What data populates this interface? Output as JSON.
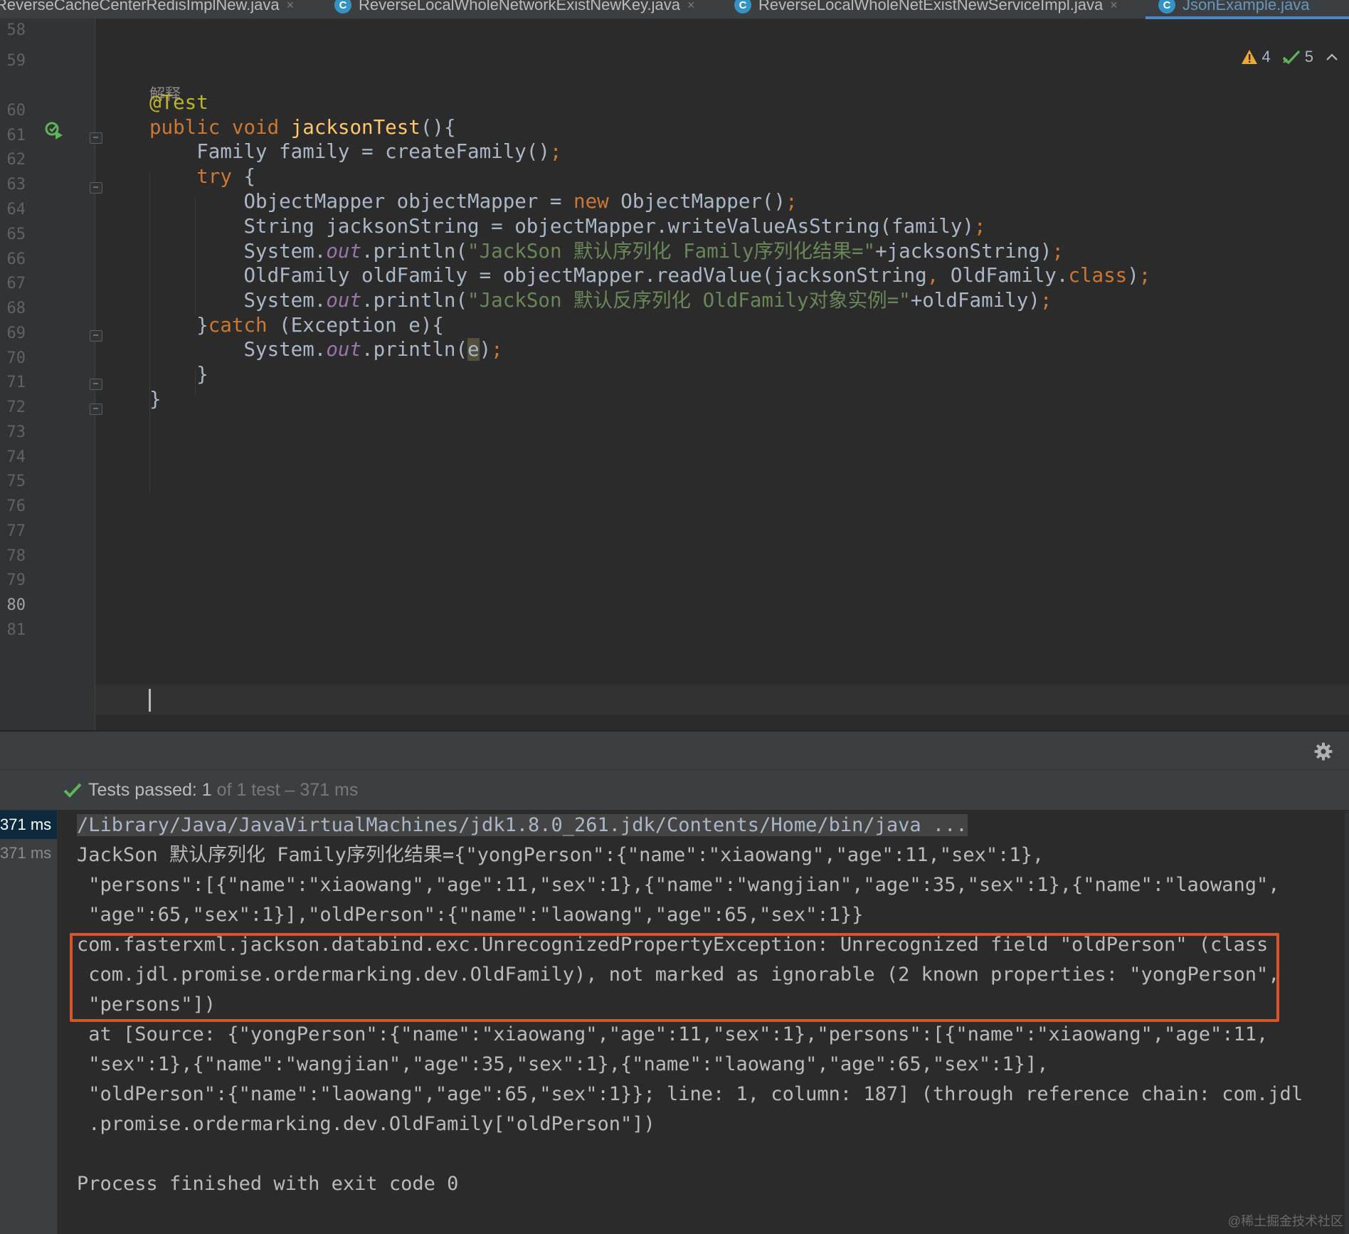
{
  "tabs": [
    {
      "label": "ReverseCacheCenterRedisImplNew.java",
      "active": false,
      "has_icon": false
    },
    {
      "label": "ReverseLocalWholeNetworkExistNewKey.java",
      "active": false,
      "has_icon": true
    },
    {
      "label": "ReverseLocalWholeNetExistNewServiceImpl.java",
      "active": false,
      "has_icon": true
    },
    {
      "label": "JsonExample.java",
      "active": true,
      "has_icon": true
    }
  ],
  "tab_close_glyph": "×",
  "tab_class_icon_letter": "C",
  "inspections": {
    "warnings": "4",
    "weak_warnings": "5"
  },
  "editor": {
    "line_numbers": [
      "58",
      "59",
      "60",
      "61",
      "62",
      "63",
      "64",
      "65",
      "66",
      "67",
      "68",
      "69",
      "70",
      "71",
      "72",
      "73",
      "74",
      "75",
      "76",
      "77",
      "78",
      "79",
      "80",
      "81"
    ],
    "current_line": "80",
    "inlay_hint": "解释",
    "lines": [
      [
        {
          "t": "@Test",
          "c": "an"
        }
      ],
      [
        {
          "t": "public ",
          "c": "kw"
        },
        {
          "t": "void ",
          "c": "kw"
        },
        {
          "t": "jacksonTest",
          "c": "fn"
        },
        {
          "t": "(){",
          "c": ""
        }
      ],
      [
        {
          "t": "    Family family = createFamily()",
          "c": ""
        },
        {
          "t": ";",
          "c": "kw"
        }
      ],
      [
        {
          "t": "    ",
          "c": ""
        },
        {
          "t": "try",
          "c": "kw"
        },
        {
          "t": " {",
          "c": ""
        }
      ],
      [
        {
          "t": "        ObjectMapper objectMapper = ",
          "c": ""
        },
        {
          "t": "new",
          "c": "kw"
        },
        {
          "t": " ObjectMapper()",
          "c": ""
        },
        {
          "t": ";",
          "c": "kw"
        }
      ],
      [
        {
          "t": "        String jacksonString = objectMapper.writeValueAsString(family)",
          "c": ""
        },
        {
          "t": ";",
          "c": "kw"
        }
      ],
      [
        {
          "t": "        System.",
          "c": ""
        },
        {
          "t": "out",
          "c": "fi"
        },
        {
          "t": ".println(",
          "c": ""
        },
        {
          "t": "\"JackSon 默认序列化 Family序列化结果=\"",
          "c": "st"
        },
        {
          "t": "+jacksonString)",
          "c": ""
        },
        {
          "t": ";",
          "c": "kw"
        }
      ],
      [
        {
          "t": "        OldFamily oldFamily = objectMapper.readValue(jacksonString",
          "c": ""
        },
        {
          "t": ", ",
          "c": "kw"
        },
        {
          "t": "OldFamily.",
          "c": ""
        },
        {
          "t": "class",
          "c": "kw"
        },
        {
          "t": ")",
          "c": ""
        },
        {
          "t": ";",
          "c": "kw"
        }
      ],
      [
        {
          "t": "        System.",
          "c": ""
        },
        {
          "t": "out",
          "c": "fi"
        },
        {
          "t": ".println(",
          "c": ""
        },
        {
          "t": "\"JackSon 默认反序列化 OldFamily对象实例=\"",
          "c": "st"
        },
        {
          "t": "+oldFamily)",
          "c": ""
        },
        {
          "t": ";",
          "c": "kw"
        }
      ],
      [
        {
          "t": "    }",
          "c": ""
        },
        {
          "t": "catch",
          "c": "kw"
        },
        {
          "t": " (Exception e){",
          "c": ""
        }
      ],
      [
        {
          "t": "        System.",
          "c": ""
        },
        {
          "t": "out",
          "c": "fi"
        },
        {
          "t": ".println(",
          "c": ""
        },
        {
          "t": "e",
          "c": "hl"
        },
        {
          "t": ")",
          "c": ""
        },
        {
          "t": ";",
          "c": "kw"
        }
      ],
      [
        {
          "t": "    }",
          "c": ""
        }
      ],
      [
        {
          "t": "}",
          "c": ""
        }
      ]
    ]
  },
  "run_panel": {
    "status_label": "Tests passed: 1",
    "status_detail": " of 1 test – 371 ms",
    "tree_items": [
      "371 ms",
      "371 ms"
    ],
    "console_lines": [
      {
        "text": "/Library/Java/JavaVirtualMachines/jdk1.8.0_261.jdk/Contents/Home/bin/java ...",
        "kind": "cmd"
      },
      {
        "text": "JackSon 默认序列化 Family序列化结果={\"yongPerson\":{\"name\":\"xiaowang\",\"age\":11,\"sex\":1},",
        "kind": "out"
      },
      {
        "text": " \"persons\":[{\"name\":\"xiaowang\",\"age\":11,\"sex\":1},{\"name\":\"wangjian\",\"age\":35,\"sex\":1},{\"name\":\"laowang\",",
        "kind": "out"
      },
      {
        "text": " \"age\":65,\"sex\":1}],\"oldPerson\":{\"name\":\"laowang\",\"age\":65,\"sex\":1}}",
        "kind": "out"
      },
      {
        "text": "com.fasterxml.jackson.databind.exc.UnrecognizedPropertyException: Unrecognized field \"oldPerson\" (class",
        "kind": "err"
      },
      {
        "text": " com.jdl.promise.ordermarking.dev.OldFamily), not marked as ignorable (2 known properties: \"yongPerson\",",
        "kind": "err"
      },
      {
        "text": " \"persons\"])",
        "kind": "err"
      },
      {
        "text": " at [Source: {\"yongPerson\":{\"name\":\"xiaowang\",\"age\":11,\"sex\":1},\"persons\":[{\"name\":\"xiaowang\",\"age\":11,",
        "kind": "out"
      },
      {
        "text": " \"sex\":1},{\"name\":\"wangjian\",\"age\":35,\"sex\":1},{\"name\":\"laowang\",\"age\":65,\"sex\":1}],",
        "kind": "out"
      },
      {
        "text": " \"oldPerson\":{\"name\":\"laowang\",\"age\":65,\"sex\":1}}; line: 1, column: 187] (through reference chain: com.jdl",
        "kind": "out"
      },
      {
        "text": " .promise.ordermarking.dev.OldFamily[\"oldPerson\"])",
        "kind": "out"
      },
      {
        "text": "",
        "kind": "out"
      },
      {
        "text": "Process finished with exit code 0",
        "kind": "out"
      }
    ]
  },
  "watermark": "@稀土掘金技术社区",
  "colors": {
    "keyword": "#cc7832",
    "method": "#ffc66d",
    "annotation": "#bbb529",
    "string": "#6a8759",
    "field": "#9876aa",
    "error_box": "#d9542b",
    "pass_green": "#5fb55a"
  }
}
